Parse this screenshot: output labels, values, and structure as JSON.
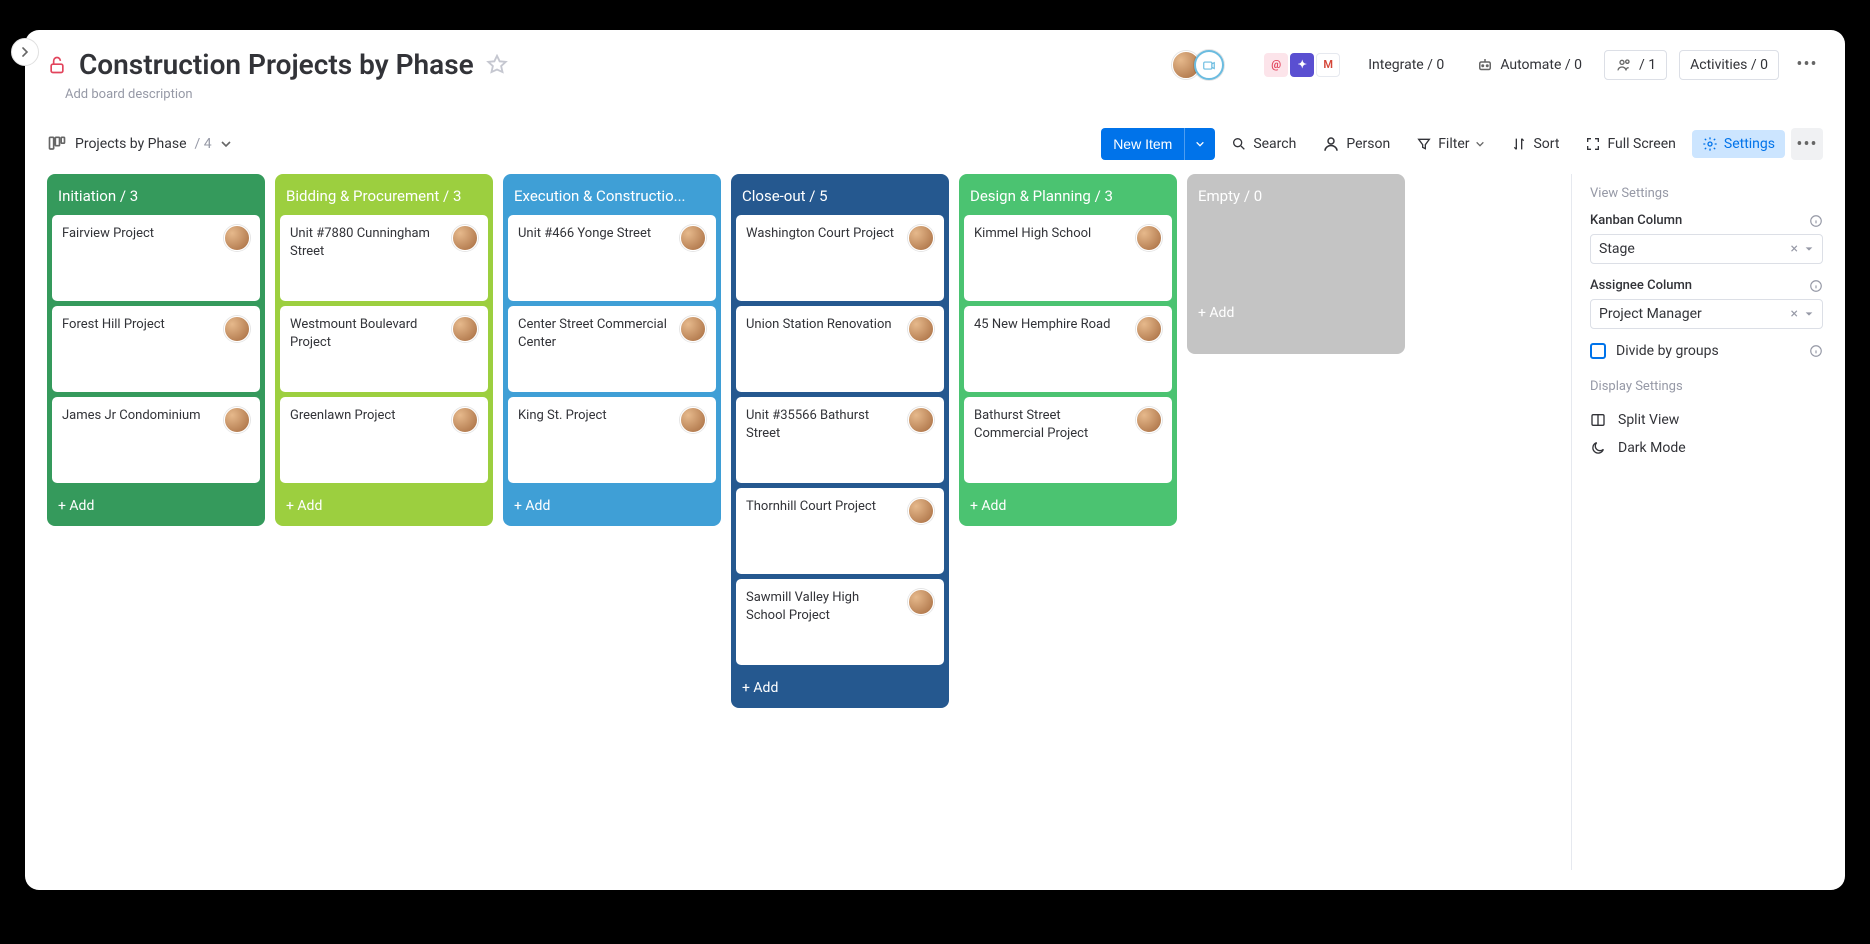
{
  "header": {
    "title": "Construction Projects by Phase",
    "description_placeholder": "Add board description",
    "integrate_label": "Integrate / 0",
    "automate_label": "Automate / 0",
    "members_label": "/ 1",
    "activities_label": "Activities / 0"
  },
  "viewbar": {
    "view_name": "Projects by Phase",
    "view_count": "/ 4"
  },
  "toolbar": {
    "new_item": "New Item",
    "search": "Search",
    "person": "Person",
    "filter": "Filter",
    "sort": "Sort",
    "full_screen": "Full Screen",
    "settings": "Settings"
  },
  "columns": [
    {
      "title": "Initiation / 3",
      "color": "c-green-dark",
      "cards": [
        {
          "title": "Fairview Project"
        },
        {
          "title": "Forest Hill Project"
        },
        {
          "title": "James Jr Condominium"
        }
      ],
      "add_label": "+ Add"
    },
    {
      "title": "Bidding & Procurement / 3",
      "color": "c-green-lime",
      "cards": [
        {
          "title": "Unit #7880 Cunningham Street"
        },
        {
          "title": "Westmount Boulevard Project"
        },
        {
          "title": "Greenlawn Project"
        }
      ],
      "add_label": "+ Add"
    },
    {
      "title": "Execution & Constructio...",
      "color": "c-blue-mid",
      "cards": [
        {
          "title": "Unit #466 Yonge Street"
        },
        {
          "title": "Center Street Commercial Center"
        },
        {
          "title": "King St. Project"
        }
      ],
      "add_label": "+ Add"
    },
    {
      "title": "Close-out / 5",
      "color": "c-blue-dark",
      "cards": [
        {
          "title": "Washington Court Project"
        },
        {
          "title": "Union Station Renovation"
        },
        {
          "title": "Unit #35566 Bathurst Street"
        },
        {
          "title": "Thornhill Court Project"
        },
        {
          "title": "Sawmill Valley High School Project"
        }
      ],
      "add_label": "+ Add"
    },
    {
      "title": "Design & Planning / 3",
      "color": "c-green-mint",
      "cards": [
        {
          "title": "Kimmel High School"
        },
        {
          "title": "45 New Hemphire Road"
        },
        {
          "title": "Bathurst Street Commercial Project"
        }
      ],
      "add_label": "+ Add"
    },
    {
      "title": "Empty / 0",
      "color": "empty",
      "cards": [],
      "add_label": "+ Add"
    }
  ],
  "sidepanel": {
    "view_settings_title": "View Settings",
    "kanban_column_label": "Kanban Column",
    "kanban_column_value": "Stage",
    "assignee_column_label": "Assignee Column",
    "assignee_column_value": "Project Manager",
    "divide_by_groups": "Divide by groups",
    "display_settings_title": "Display Settings",
    "split_view": "Split View",
    "dark_mode": "Dark Mode"
  }
}
